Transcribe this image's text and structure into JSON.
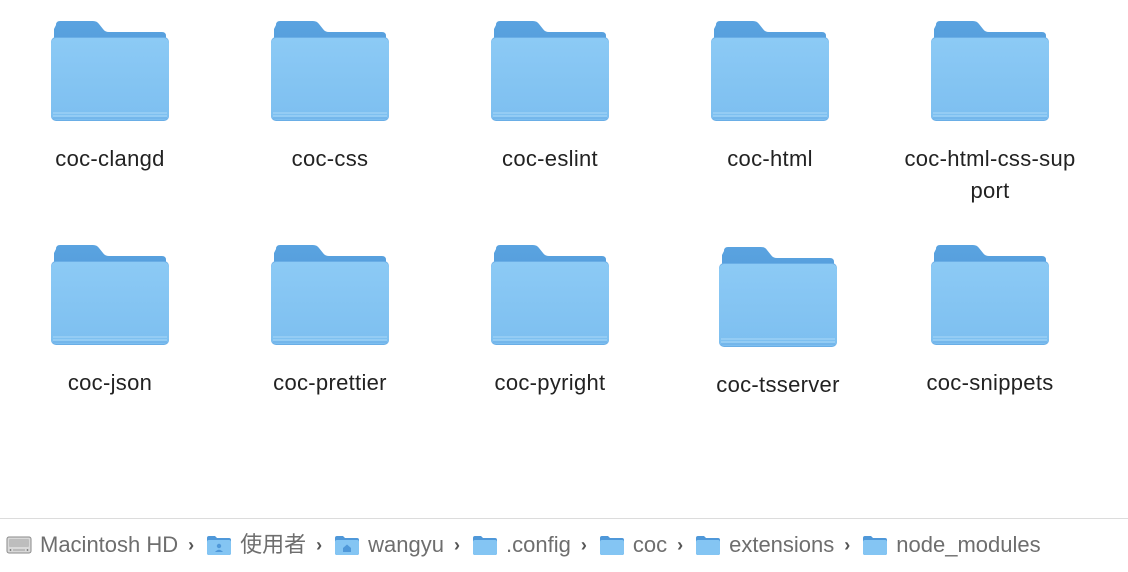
{
  "folders": [
    {
      "label": "coc-clangd"
    },
    {
      "label": "coc-css"
    },
    {
      "label": "coc-eslint"
    },
    {
      "label": "coc-html"
    },
    {
      "label": "coc-html-css-support"
    },
    {
      "label": "coc-json"
    },
    {
      "label": "coc-prettier"
    },
    {
      "label": "coc-pyright"
    },
    {
      "label": "coc-tsserver"
    },
    {
      "label": "coc-snippets"
    }
  ],
  "pathbar": {
    "items": [
      {
        "label": "Macintosh HD",
        "icon": "hard-drive-icon"
      },
      {
        "label": "使用者",
        "icon": "users-folder-icon"
      },
      {
        "label": "wangyu",
        "icon": "home-folder-icon"
      },
      {
        "label": ".config",
        "icon": "folder-icon"
      },
      {
        "label": "coc",
        "icon": "folder-icon"
      },
      {
        "label": "extensions",
        "icon": "folder-icon"
      },
      {
        "label": "node_modules",
        "icon": "folder-icon"
      }
    ],
    "separator": "›"
  },
  "colors": {
    "folder_front": "#84c5f3",
    "folder_back": "#4f98d9",
    "label_text": "#222222",
    "path_text": "#6e6e6e"
  }
}
